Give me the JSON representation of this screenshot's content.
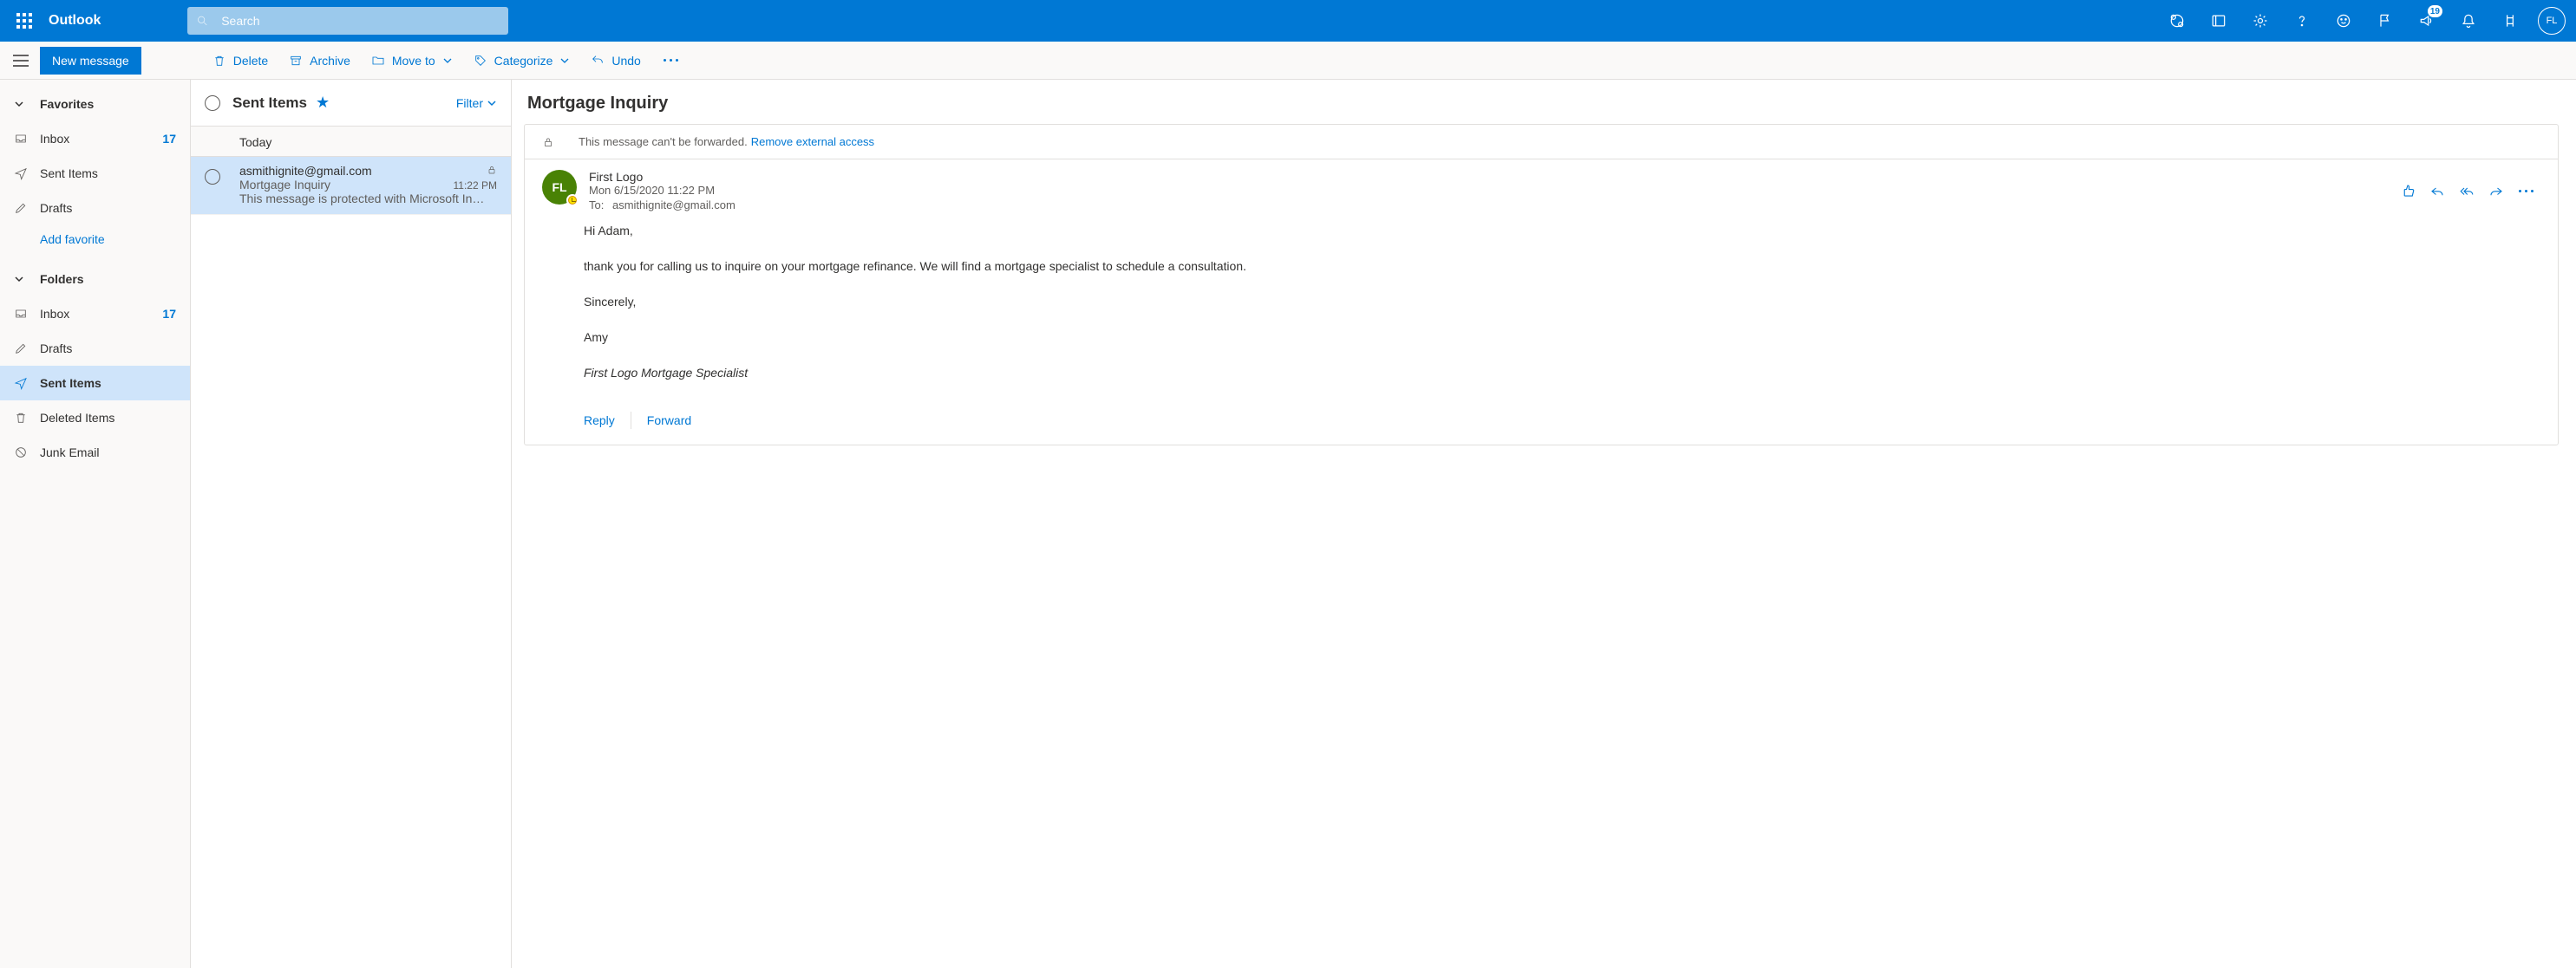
{
  "header": {
    "brand": "Outlook",
    "search_placeholder": "Search",
    "badge": "19",
    "avatar_initials": "FL"
  },
  "commands": {
    "new_message": "New message",
    "delete": "Delete",
    "archive": "Archive",
    "move_to": "Move to",
    "categorize": "Categorize",
    "undo": "Undo"
  },
  "sidebar": {
    "favorites_label": "Favorites",
    "folders_label": "Folders",
    "add_favorite": "Add favorite",
    "fav": {
      "inbox": {
        "label": "Inbox",
        "count": "17"
      },
      "sent": {
        "label": "Sent Items"
      },
      "drafts": {
        "label": "Drafts"
      }
    },
    "fld": {
      "inbox": {
        "label": "Inbox",
        "count": "17"
      },
      "drafts": {
        "label": "Drafts"
      },
      "sent": {
        "label": "Sent Items"
      },
      "deleted": {
        "label": "Deleted Items"
      },
      "junk": {
        "label": "Junk Email"
      }
    }
  },
  "list": {
    "title": "Sent Items",
    "filter": "Filter",
    "group": "Today",
    "msg": {
      "from": "asmithignite@gmail.com",
      "subject": "Mortgage Inquiry",
      "time": "11:22 PM",
      "preview": "This message is protected with Microsoft In…"
    }
  },
  "reading": {
    "subject": "Mortgage Inquiry",
    "banner_text": "This message can't be forwarded.",
    "banner_link": "Remove external access",
    "sender_name": "First Logo",
    "sender_initials": "FL",
    "datetime": "Mon 6/15/2020 11:22 PM",
    "to_label": "To:",
    "to_value": "asmithignite@gmail.com",
    "body": {
      "greeting": "Hi Adam,",
      "para1": " thank you for calling us to inquire on your mortgage refinance.  We will find a mortgage specialist to schedule a consultation.",
      "signoff": "Sincerely,",
      "name": "Amy",
      "signature": "First Logo Mortgage Specialist"
    },
    "reply": "Reply",
    "forward": "Forward"
  }
}
